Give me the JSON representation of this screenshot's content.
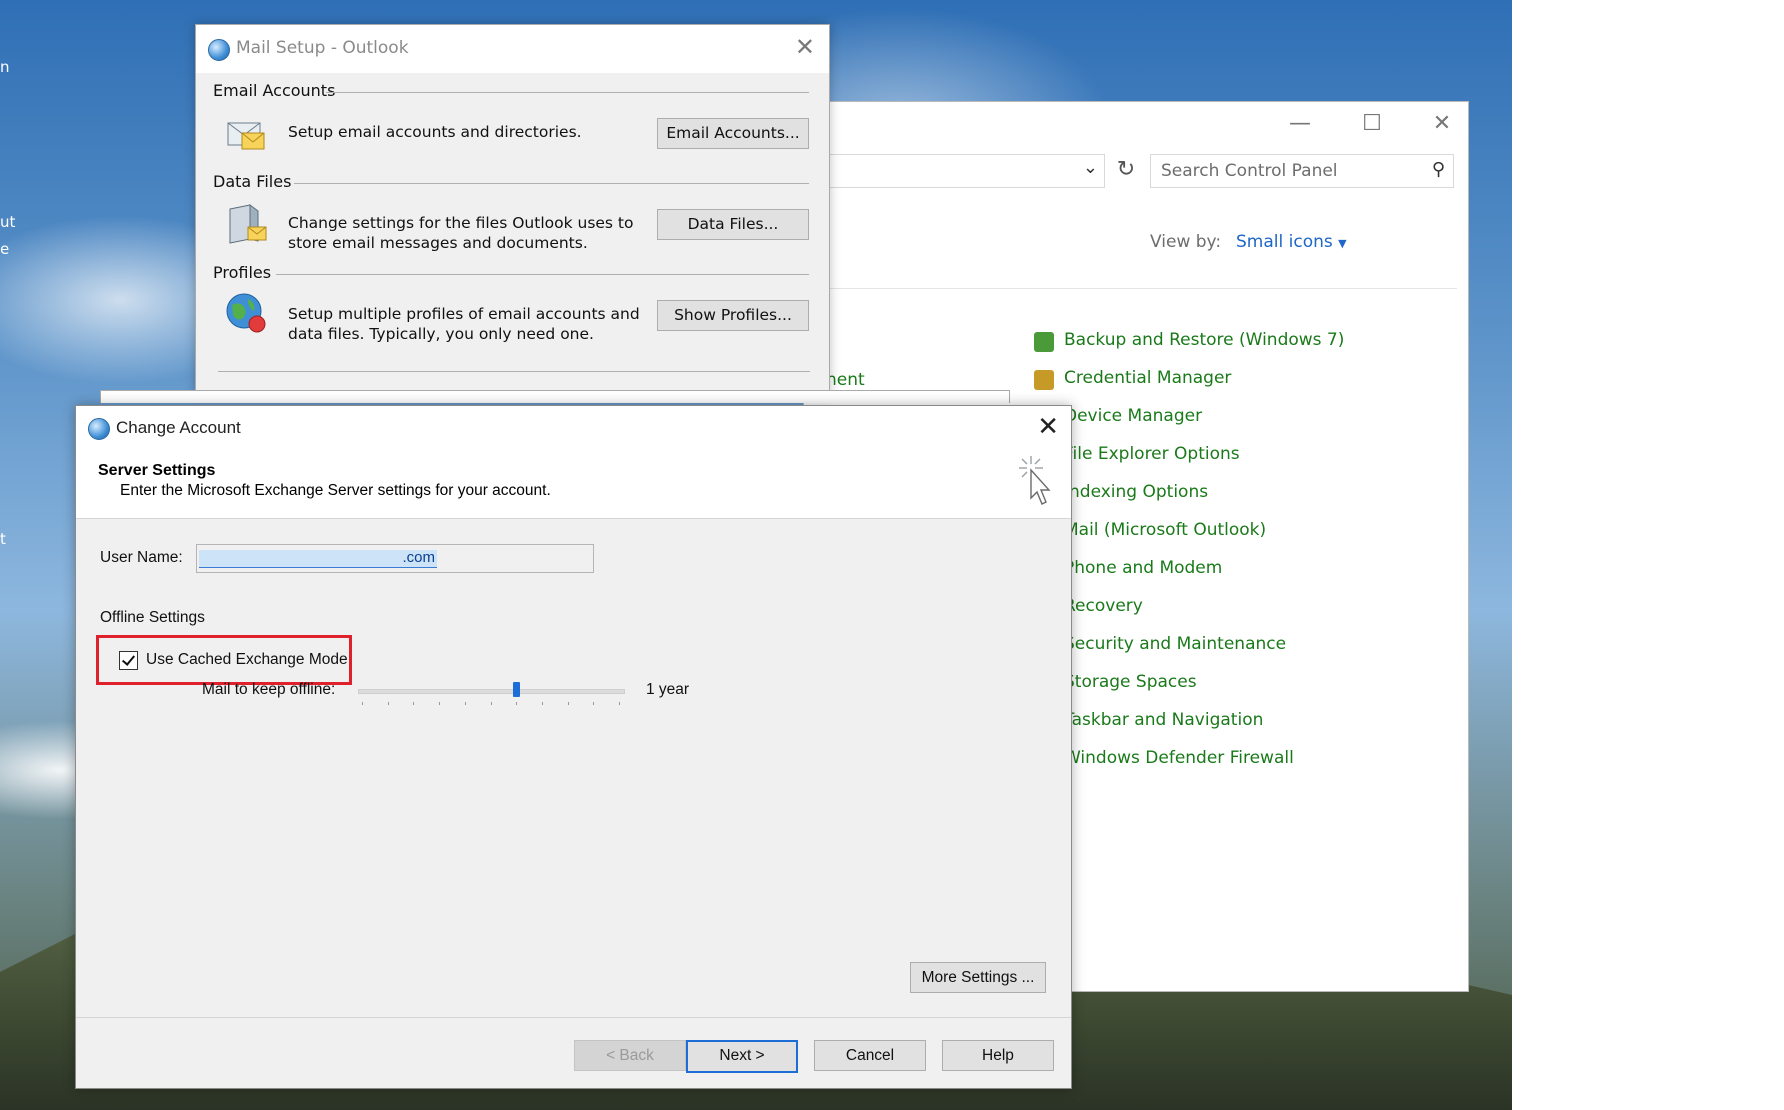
{
  "desktop": {
    "edge_fragments": [
      "n",
      "ut",
      "e",
      "t"
    ]
  },
  "control_panel": {
    "search_placeholder": "Search Control Panel",
    "view_by_label": "View by:",
    "view_by_value": "Small icons",
    "behind_text": "nent",
    "items": [
      {
        "label": "Backup and Restore (Windows 7)",
        "icon": "backup-icon"
      },
      {
        "label": "Credential Manager",
        "icon": "credential-icon"
      },
      {
        "label": "Device Manager",
        "icon": "device-icon"
      },
      {
        "label": "File Explorer Options",
        "icon": "folder-icon"
      },
      {
        "label": "Indexing Options",
        "icon": "index-icon"
      },
      {
        "label": "Mail (Microsoft Outlook)",
        "icon": "mail-icon"
      },
      {
        "label": "Phone and Modem",
        "icon": "phone-icon"
      },
      {
        "label": "Recovery",
        "icon": "recovery-icon"
      },
      {
        "label": "Security and Maintenance",
        "icon": "security-icon"
      },
      {
        "label": "Storage Spaces",
        "icon": "storage-icon"
      },
      {
        "label": "Taskbar and Navigation",
        "icon": "taskbar-icon"
      },
      {
        "label": "Windows Defender Firewall",
        "icon": "firewall-icon"
      }
    ]
  },
  "mail_setup": {
    "title": "Mail Setup - Outlook",
    "sections": [
      {
        "heading": "Email Accounts",
        "desc": "Setup email accounts and directories.",
        "button": "Email Accounts..."
      },
      {
        "heading": "Data Files",
        "desc": "Change settings for the files Outlook uses to store email messages and documents.",
        "button": "Data Files..."
      },
      {
        "heading": "Profiles",
        "desc": "Setup multiple profiles of email accounts and data files. Typically, you only need one.",
        "button": "Show Profiles..."
      }
    ]
  },
  "change_account": {
    "title": "Change Account",
    "heading": "Server Settings",
    "subheading": "Enter the Microsoft Exchange Server settings for your account.",
    "user_name_label": "User Name:",
    "user_name_value": ".com",
    "offline_label": "Offline Settings",
    "cached_mode_label": "Use Cached Exchange Mode",
    "cached_mode_checked": true,
    "mail_offline_label": "Mail to keep offline:",
    "mail_offline_value": "1 year",
    "slider_fraction": 0.6,
    "more_settings": "More Settings ...",
    "back": "< Back",
    "next": "Next >",
    "cancel": "Cancel",
    "help": "Help"
  },
  "colors": {
    "link_green": "#1a7a1a",
    "accent_blue": "#1c6ed6",
    "highlight_red": "#e0202a"
  }
}
